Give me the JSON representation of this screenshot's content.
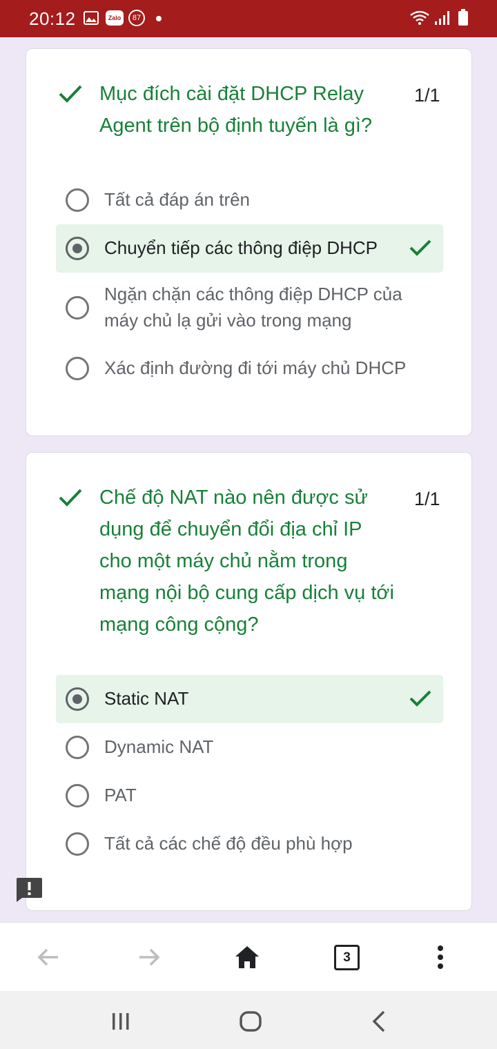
{
  "status_bar": {
    "time": "20:12",
    "notification_count": "87",
    "icons": [
      "gallery-icon",
      "zalo-icon",
      "notification-badge",
      "dot-icon",
      "wifi-icon",
      "signal-icon",
      "battery-icon"
    ],
    "zalo_label": "Zalo",
    "background": "#a51c1c"
  },
  "questions": [
    {
      "title": "Mục đích cài đặt DHCP Relay Agent trên bộ định tuyến là gì?",
      "score": "1/1",
      "correct": true,
      "options": [
        {
          "label": "Tất cả đáp án trên",
          "selected": false
        },
        {
          "label": "Chuyển tiếp các thông điệp DHCP",
          "selected": true,
          "correct": true
        },
        {
          "label": "Ngặn chặn các thông điệp DHCP của máy chủ lạ gửi vào trong mạng",
          "selected": false
        },
        {
          "label": "Xác định đường đi tới máy chủ DHCP",
          "selected": false
        }
      ]
    },
    {
      "title": "Chế độ NAT nào nên được sử dụng để chuyển đổi địa chỉ IP cho một máy chủ nằm trong mạng nội bộ cung cấp dịch vụ tới mạng công cộng?",
      "score": "1/1",
      "correct": true,
      "options": [
        {
          "label": "Static NAT",
          "selected": true,
          "correct": true
        },
        {
          "label": "Dynamic NAT",
          "selected": false
        },
        {
          "label": "PAT",
          "selected": false
        },
        {
          "label": "Tất cả các chế độ đều phù hợp",
          "selected": false
        }
      ]
    }
  ],
  "browser_toolbar": {
    "tab_count": "3"
  },
  "colors": {
    "correct_green": "#188038",
    "selected_bg": "#e6f4ea",
    "page_bg": "#ede7f6"
  }
}
